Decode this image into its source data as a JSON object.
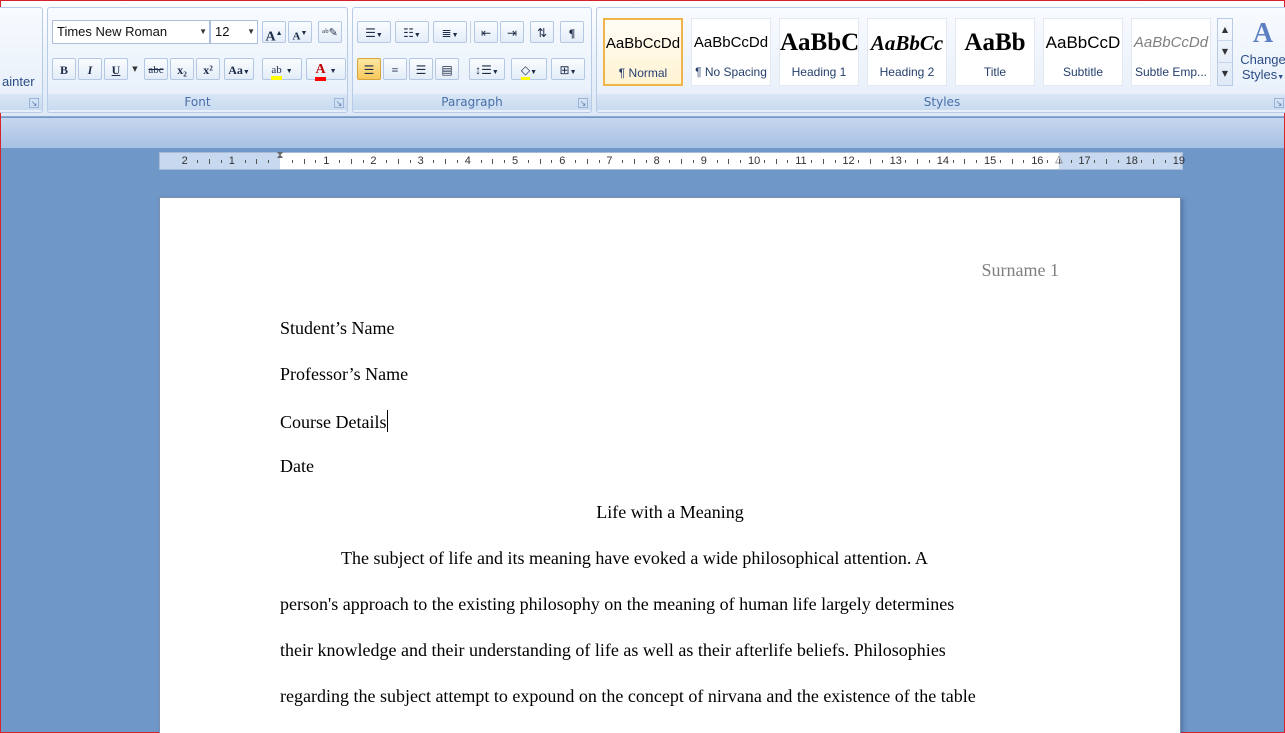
{
  "clipboard": {
    "format_painter_label": "ainter"
  },
  "font": {
    "group_label": "Font",
    "name": "Times New Roman",
    "size": "12",
    "bold": "B",
    "italic": "I",
    "underline": "U",
    "strike": "abc",
    "subscript": "x₂",
    "superscript": "x²",
    "change_case": "Aa",
    "highlight": "ab",
    "font_color": "A",
    "grow": "A",
    "shrink": "A"
  },
  "paragraph": {
    "group_label": "Paragraph"
  },
  "styles": {
    "group_label": "Styles",
    "items": [
      {
        "sample": "AaBbCcDd",
        "name": "¶ Normal"
      },
      {
        "sample": "AaBbCcDd",
        "name": "¶ No Spacing"
      },
      {
        "sample": "AaBbC",
        "name": "Heading 1"
      },
      {
        "sample": "AaBbCc",
        "name": "Heading 2"
      },
      {
        "sample": "AaBb",
        "name": "Title"
      },
      {
        "sample": "AaBbCcD",
        "name": "Subtitle"
      },
      {
        "sample": "AaBbCcDd",
        "name": "Subtle Emp..."
      }
    ],
    "change_styles": "Change Styles"
  },
  "ruler": {
    "labels": [
      "2",
      "1",
      "1",
      "2",
      "3",
      "4",
      "5",
      "6",
      "7",
      "8",
      "9",
      "10",
      "11",
      "12",
      "13",
      "14",
      "15",
      "16",
      "17",
      "18",
      "19"
    ]
  },
  "document": {
    "header": "Surname 1",
    "lines": [
      "Student’s Name",
      "Professor’s Name",
      "Course Details",
      "Date"
    ],
    "title": "Life with a Meaning",
    "paragraph": [
      "The subject of life and its meaning have evoked a wide philosophical attention. A",
      "person's approach to the existing philosophy on the meaning of human life largely determines",
      "their knowledge and their understanding of life as well as their afterlife beliefs. Philosophies",
      "regarding the subject attempt to expound on the concept of nirvana and the existence of the table"
    ]
  },
  "colors": {
    "highlight": "#ffff00",
    "font_color": "#ff0000",
    "accent": "#f0b44b"
  }
}
